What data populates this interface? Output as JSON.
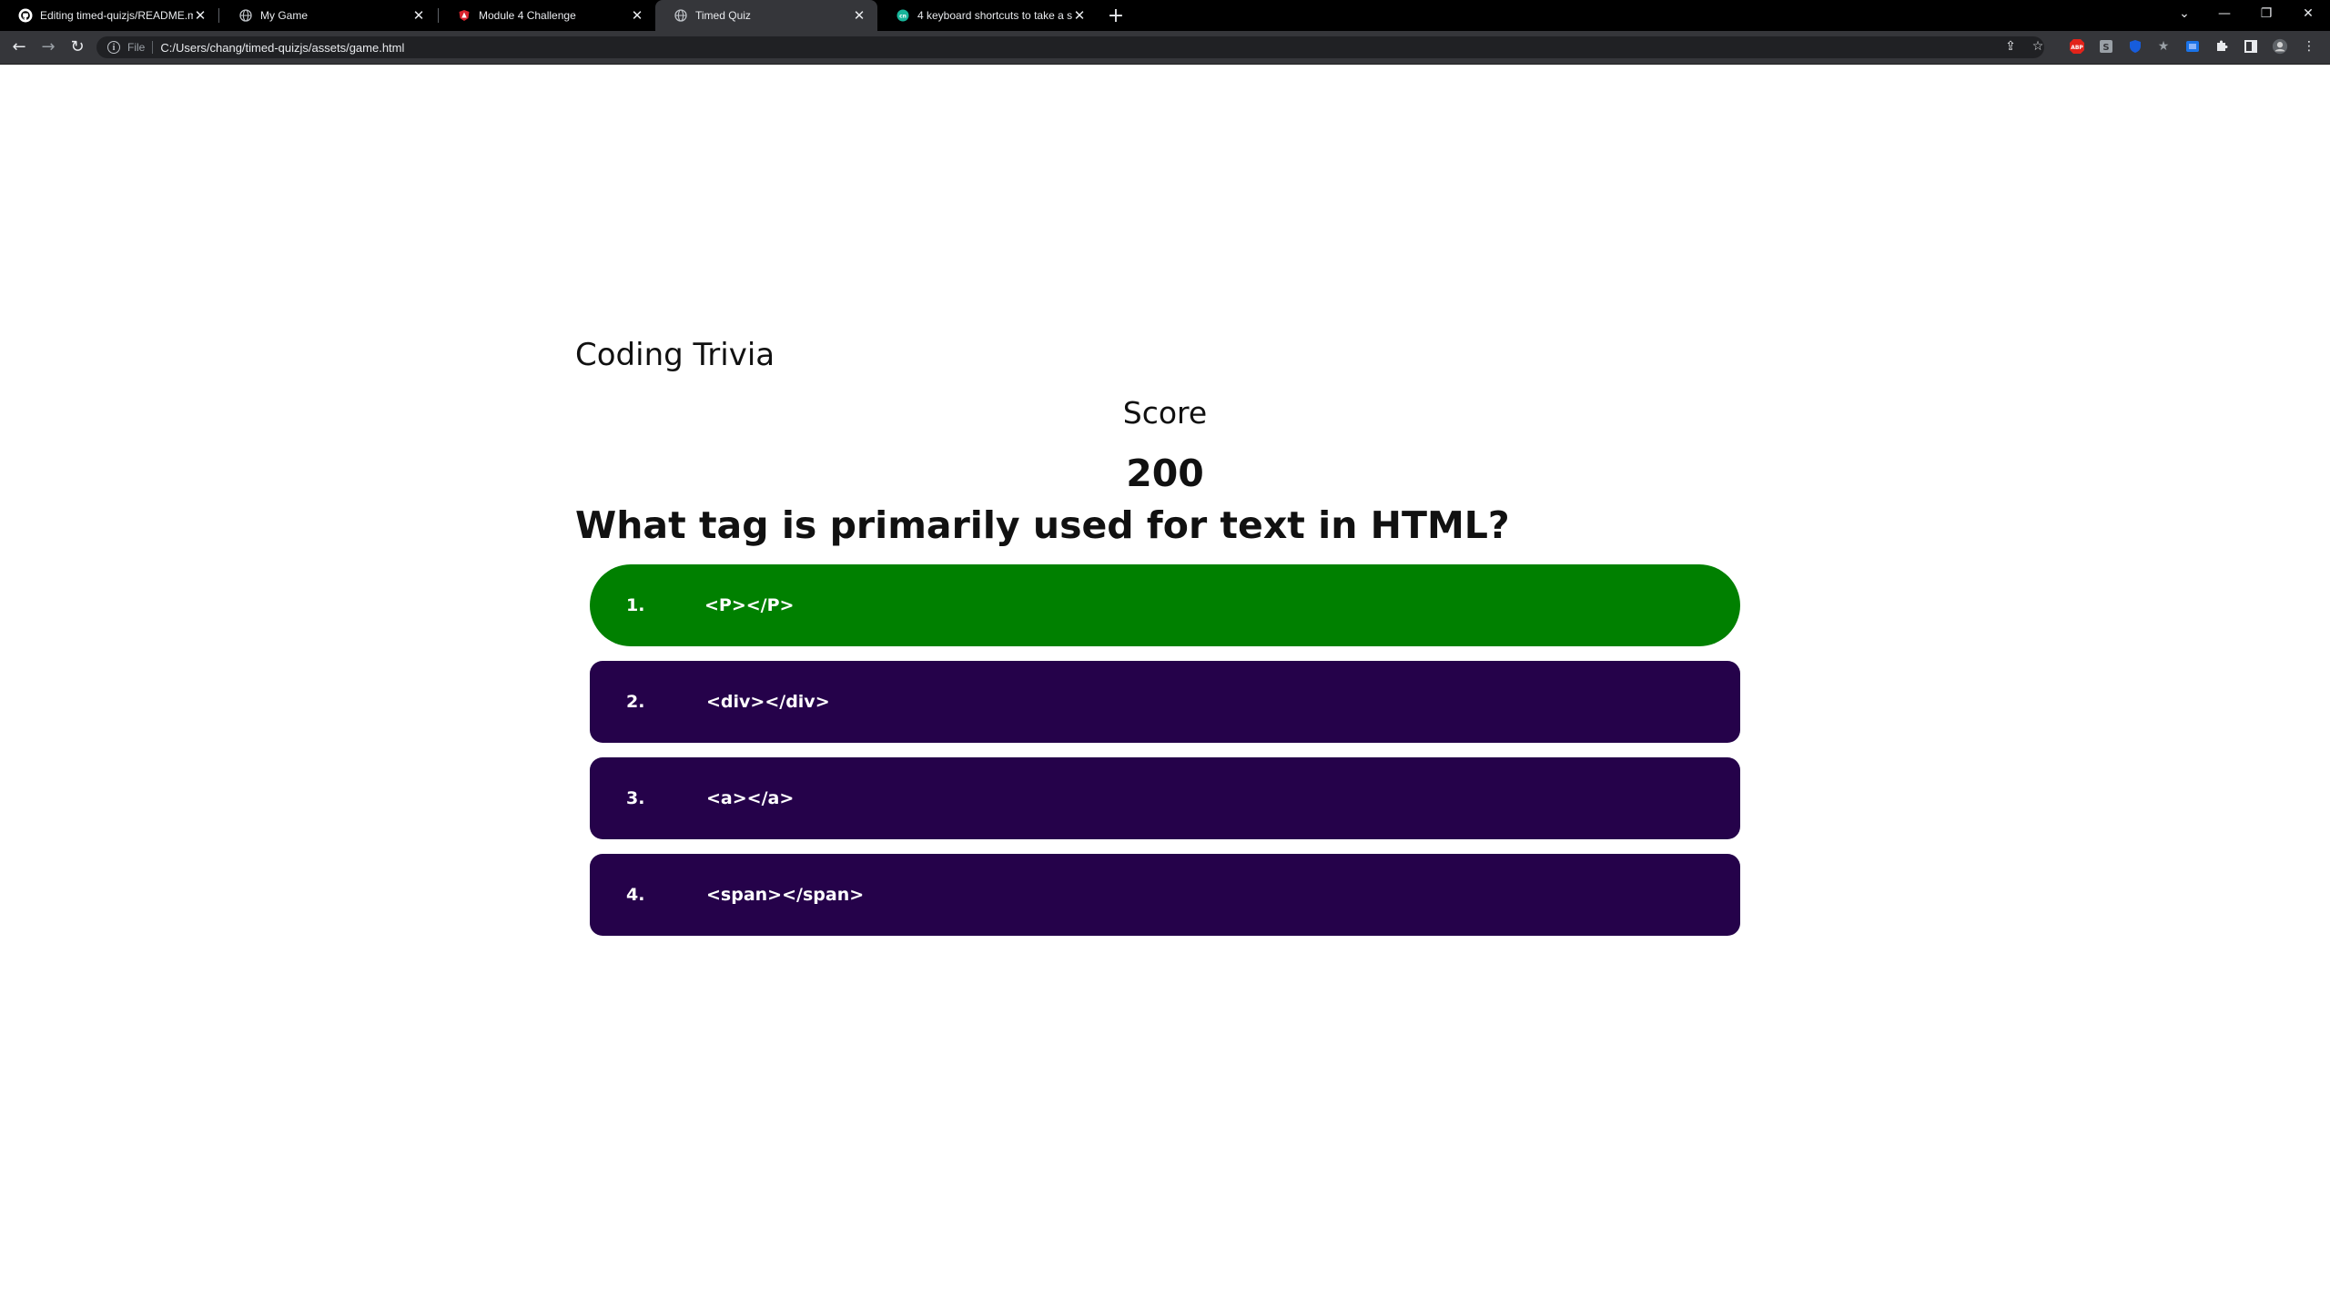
{
  "browser": {
    "tabs": [
      {
        "title": "Editing timed-quizjs/README.md",
        "icon": "github-icon",
        "active": false
      },
      {
        "title": "My Game",
        "icon": "globe-icon",
        "active": false
      },
      {
        "title": "Module 4 Challenge",
        "icon": "shield-icon",
        "active": false
      },
      {
        "title": "Timed Quiz",
        "icon": "globe-icon",
        "active": true
      },
      {
        "title": "4 keyboard shortcuts to take a sc",
        "icon": "site-icon",
        "active": false
      }
    ],
    "new_tab": "+",
    "address": {
      "scheme": "File",
      "url": "C:/Users/chang/timed-quizjs/assets/game.html"
    },
    "window_controls": [
      "chevron-down-icon",
      "minimize-icon",
      "restore-icon",
      "close-icon"
    ],
    "toolbar_icons": [
      "share-icon",
      "bookmark-star-icon",
      "abp-extension-icon",
      "extension-icon",
      "shield-extension-icon",
      "star-extension-icon",
      "extension-icon",
      "puzzle-icon",
      "sidepanel-icon",
      "avatar-icon",
      "menu-icon"
    ],
    "abp_label": "ABP"
  },
  "page": {
    "app_title": "Coding Trivia",
    "score_label": "Score",
    "score_value": "200",
    "question": "What tag is primarily used for text in HTML?",
    "choices": [
      {
        "number": "1.",
        "text": "<P></P>",
        "state": "correct"
      },
      {
        "number": "2.",
        "text": "<div></div>",
        "state": "default"
      },
      {
        "number": "3.",
        "text": "<a></a>",
        "state": "default"
      },
      {
        "number": "4.",
        "text": "<span></span>",
        "state": "default"
      }
    ],
    "colors": {
      "correct": "#008000",
      "default": "#25024a",
      "text": "#ffffff"
    }
  }
}
